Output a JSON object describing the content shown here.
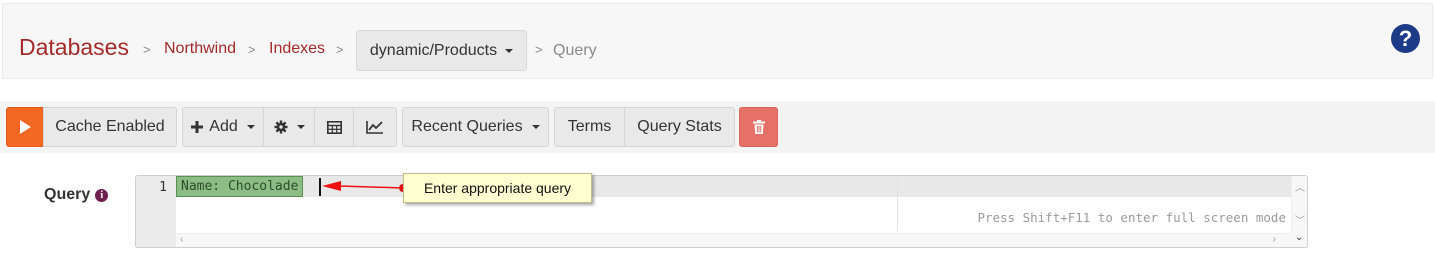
{
  "breadcrumb": {
    "root": "Databases",
    "separator": ">",
    "database": "Northwind",
    "section": "Indexes",
    "index_selector": "dynamic/Products",
    "current": "Query"
  },
  "toolbar": {
    "cache_label": "Cache Enabled",
    "add_label": "Add",
    "recent_label": "Recent Queries",
    "terms_label": "Terms",
    "stats_label": "Query Stats"
  },
  "query": {
    "label": "Query",
    "line_number": "1",
    "text": "Name: Chocolade",
    "fullscreen_hint": "Press Shift+F11 to enter full screen mode"
  },
  "annotation": {
    "text": "Enter appropriate query"
  },
  "colors": {
    "brand_red": "#a52a2a",
    "run_orange": "#f26722",
    "delete_red": "#e57168",
    "help_blue": "#1d3a86",
    "highlight_green": "#8bbd85"
  },
  "icons": {
    "run": "play-icon",
    "add": "plus-icon",
    "settings": "gear-icon",
    "table": "table-icon",
    "chart": "line-chart-icon",
    "delete": "trash-icon",
    "help": "question-circle-icon",
    "info": "info-circle-icon"
  }
}
